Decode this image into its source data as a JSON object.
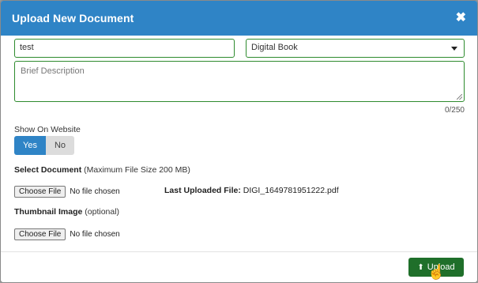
{
  "modal": {
    "title": "Upload New Document",
    "close_glyph": "✖"
  },
  "form": {
    "title_value": "test",
    "type_value": "Digital Book",
    "description_placeholder": "Brief Description",
    "char_counter": "0/250",
    "show_on_website_label": "Show On Website",
    "toggle_yes": "Yes",
    "toggle_no": "No",
    "select_doc_bold": "Select Document",
    "select_doc_note": "(Maximum File Size 200 MB)",
    "choose_file_label": "Choose File",
    "no_file_text": "No file chosen",
    "last_uploaded_label": "Last Uploaded File:",
    "last_uploaded_value": "DIGI_1649781951222.pdf",
    "thumbnail_bold": "Thumbnail Image",
    "thumbnail_note": "(optional)"
  },
  "footer": {
    "upload_label": "Upload"
  },
  "colors": {
    "header": "#2f84c6",
    "field_border": "#2e8b2e",
    "upload_button": "#1f6f2a"
  },
  "icons": [
    "close-icon",
    "chevron-down-icon",
    "upload-icon",
    "hand-cursor-icon"
  ]
}
